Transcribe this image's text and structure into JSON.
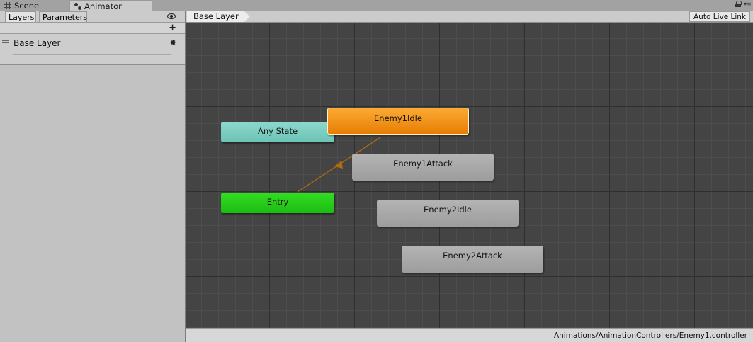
{
  "window_tabs": [
    {
      "label": "Scene",
      "icon": "grid-icon"
    },
    {
      "label": "Animator",
      "icon": "animator-icon"
    }
  ],
  "left_panel": {
    "tabs": [
      "Layers",
      "Parameters"
    ],
    "add_button": "+",
    "layers": [
      {
        "name": "Base Layer"
      }
    ]
  },
  "graph": {
    "breadcrumb": "Base Layer",
    "auto_live_link": "Auto Live Link",
    "states": {
      "any_state": "Any State",
      "entry": "Entry",
      "enemy1_idle": "Enemy1Idle",
      "enemy1_attack": "Enemy1Attack",
      "enemy2_idle": "Enemy2Idle",
      "enemy2_attack": "Enemy2Attack"
    },
    "default_state": "Enemy1Idle",
    "colors": {
      "default_state": "#f08c1a",
      "any_state": "#7dd0c2",
      "entry": "#28cc1a",
      "state": "#a8a8a8",
      "transition": "#b06a10"
    }
  },
  "status_bar": {
    "path": "Animations/AnimationControllers/Enemy1.controller"
  }
}
